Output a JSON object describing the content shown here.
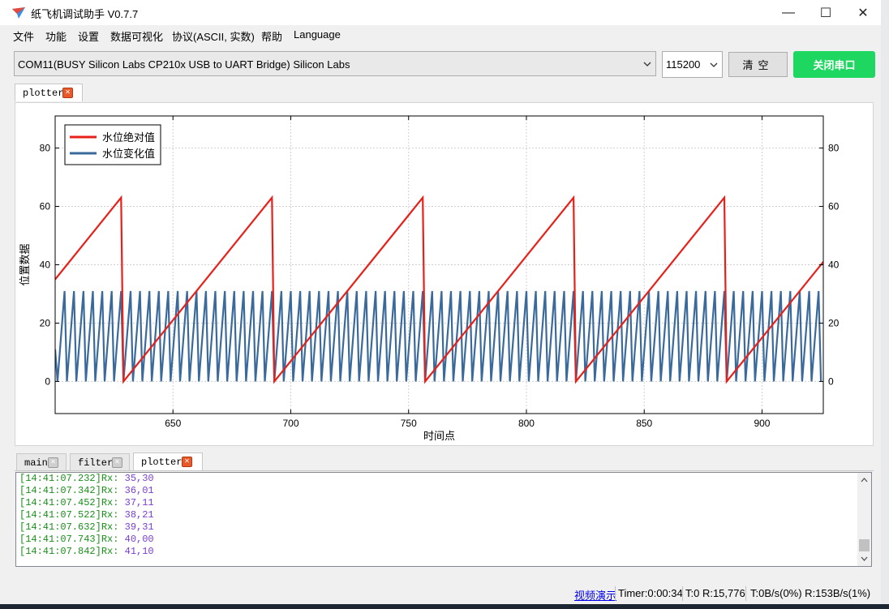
{
  "window": {
    "title": "纸飞机调试助手 V0.7.7",
    "minimize": "—",
    "maximize": "☐",
    "close": "✕"
  },
  "menu": [
    "文件",
    "功能",
    "设置",
    "数据可视化",
    "协议(ASCII, 实数)",
    "帮助",
    "Language"
  ],
  "toolbar": {
    "port": "COM11(BUSY  Silicon Labs CP210x USB to UART Bridge) Silicon Labs",
    "baud": "115200",
    "clear_label": "清空",
    "close_port_label": "关闭串口",
    "close_port_color": "#1ed760"
  },
  "top_tabs": [
    {
      "label": "plotter",
      "active": true
    }
  ],
  "chart_data": {
    "type": "line",
    "xlabel": "时间点",
    "ylabel": "位置数据",
    "xlim": [
      600,
      926
    ],
    "ylim": [
      -11,
      91
    ],
    "xticks": [
      650,
      700,
      750,
      800,
      850,
      900
    ],
    "yticks": [
      0,
      20,
      40,
      60,
      80
    ],
    "grid": true,
    "legend_position": "top-left",
    "series": [
      {
        "name": "水位绝对值",
        "color": "#e8201a",
        "pattern": "sawtooth",
        "x_start": 600,
        "x_end": 926,
        "start_value": 35,
        "peak": 63,
        "period": 64,
        "first_peak_x": 628
      },
      {
        "name": "水位变化值",
        "color": "#3a6a9c",
        "pattern": "sawtooth",
        "x_start": 600,
        "x_end": 926,
        "peak": 31,
        "min": 0,
        "period": 4
      }
    ]
  },
  "bottom_tabs": [
    {
      "label": "main",
      "active": false
    },
    {
      "label": "filter",
      "active": false
    },
    {
      "label": "plotter",
      "active": true
    }
  ],
  "log": [
    {
      "ts": "[14:41:07.232]Rx:",
      "val": "35,30"
    },
    {
      "ts": "[14:41:07.342]Rx:",
      "val": "36,01"
    },
    {
      "ts": "[14:41:07.452]Rx:",
      "val": "37,11"
    },
    {
      "ts": "[14:41:07.522]Rx:",
      "val": "38,21"
    },
    {
      "ts": "[14:41:07.632]Rx:",
      "val": "39,31"
    },
    {
      "ts": "[14:41:07.743]Rx:",
      "val": "40,00"
    },
    {
      "ts": "[14:41:07.842]Rx:",
      "val": "41,10"
    }
  ],
  "status": {
    "video_link": "视频演示",
    "timer": "Timer:0:00:34",
    "counts": "T:0 R:15,776",
    "rates": "T:0B/s(0%) R:153B/s(1%)"
  }
}
